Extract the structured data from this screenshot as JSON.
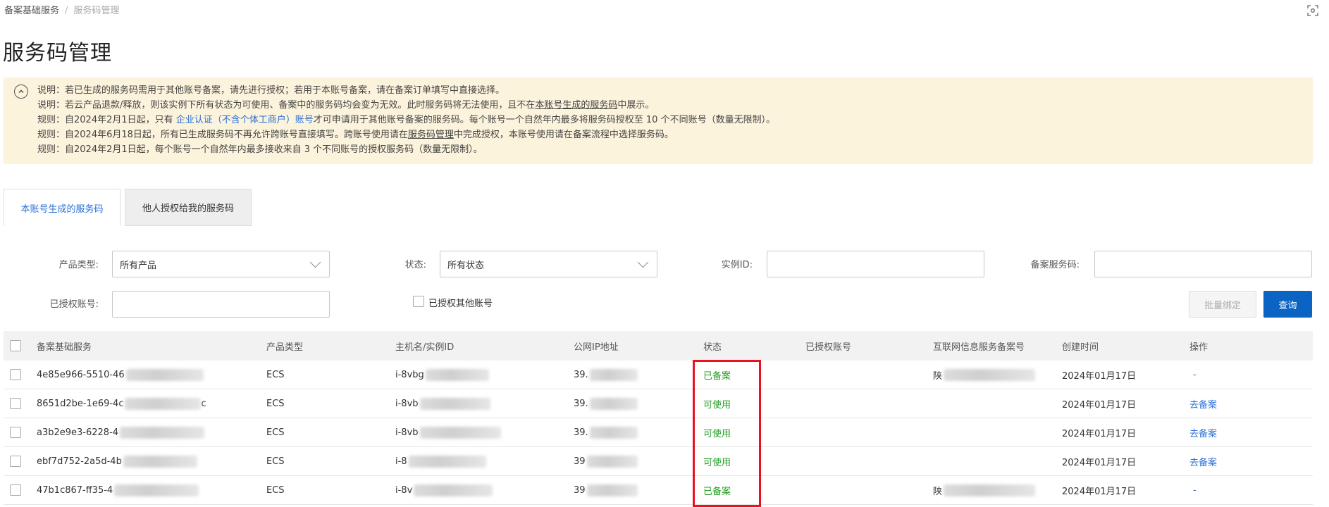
{
  "breadcrumb": {
    "root": "备案基础服务",
    "current": "服务码管理"
  },
  "page_title": "服务码管理",
  "notice": {
    "line1": "说明：若已生成的服务码需用于其他账号备案，请先进行授权；若用于本账号备案，请在备案订单填写中直接选择。",
    "line2_pre": "说明：若云产品退款/释放，则该实例下所有状态为可使用、备案中的服务码均会变为无效。此时服务码将无法使用，且不在",
    "line2_link": "本账号生成的服务码",
    "line2_post": "中展示。",
    "line3_pre": "规则：自2024年2月1日起，只有 ",
    "line3_link": "企业认证（不含个体工商户）账号",
    "line3_post": "才可申请用于其他账号备案的服务码。每个账号一个自然年内最多将服务码授权至 10 个不同账号（数量无限制）。",
    "line4_pre": "规则：自2024年6月18日起，所有已生成服务码不再允许跨账号直接填写。跨账号使用请在",
    "line4_link": "服务码管理",
    "line4_post": "中完成授权，本账号使用请在备案流程中选择服务码。",
    "line5": "规则：自2024年2月1日起，每个账号一个自然年内最多接收来自 3 个不同账号的授权服务码（数量无限制）。"
  },
  "tabs": [
    {
      "label": "本账号生成的服务码",
      "active": true
    },
    {
      "label": "他人授权给我的服务码",
      "active": false
    }
  ],
  "filters": {
    "product_type_label": "产品类型:",
    "product_type_value": "所有产品",
    "status_label": "状态:",
    "status_value": "所有状态",
    "instance_id_label": "实例ID:",
    "instance_id_value": "",
    "service_code_label": "备案服务码:",
    "service_code_value": "",
    "authorized_account_label": "已授权账号:",
    "authorized_account_value": "",
    "authorized_other_label": "已授权其他账号",
    "authorized_other_checked": false
  },
  "buttons": {
    "batch_bind": "批量绑定",
    "query": "查询"
  },
  "table": {
    "headers": [
      "备案基础服务",
      "产品类型",
      "主机名/实例ID",
      "公网IP地址",
      "状态",
      "已授权账号",
      "互联网信息服务备案号",
      "创建时间",
      "操作"
    ],
    "rows": [
      {
        "code": "4e85e966-5510-46",
        "product": "ECS",
        "instance": "i-8vbg",
        "ip": "39.",
        "status": "已备案",
        "authorized": "",
        "icp": "陕",
        "created": "2024年01月17日",
        "action": "-"
      },
      {
        "code": "8651d2be-1e69-4c",
        "code_tail": "c",
        "product": "ECS",
        "instance": "i-8vb",
        "ip": "39.",
        "status": "可使用",
        "authorized": "",
        "icp": "",
        "created": "2024年01月17日",
        "action": "去备案"
      },
      {
        "code": "a3b2e9e3-6228-4",
        "product": "ECS",
        "instance": "i-8vb",
        "ip": "39.",
        "status": "可使用",
        "authorized": "",
        "icp": "",
        "created": "2024年01月17日",
        "action": "去备案"
      },
      {
        "code": "ebf7d752-2a5d-4b",
        "product": "ECS",
        "instance": "i-8",
        "ip": "39",
        "status": "可使用",
        "authorized": "",
        "icp": "",
        "created": "2024年01月17日",
        "action": "去备案"
      },
      {
        "code": "47b1c867-ff35-4",
        "product": "ECS",
        "instance": "i-8v",
        "ip": "39",
        "status": "已备案",
        "authorized": "",
        "icp": "陕",
        "created": "2024年01月17日",
        "action": "-"
      }
    ]
  },
  "colors": {
    "accent": "#0b63c4",
    "link": "#2a6fd6",
    "status_ok": "#1e9e1e",
    "notice_bg": "#fcf3dc",
    "highlight": "#e8131f"
  }
}
